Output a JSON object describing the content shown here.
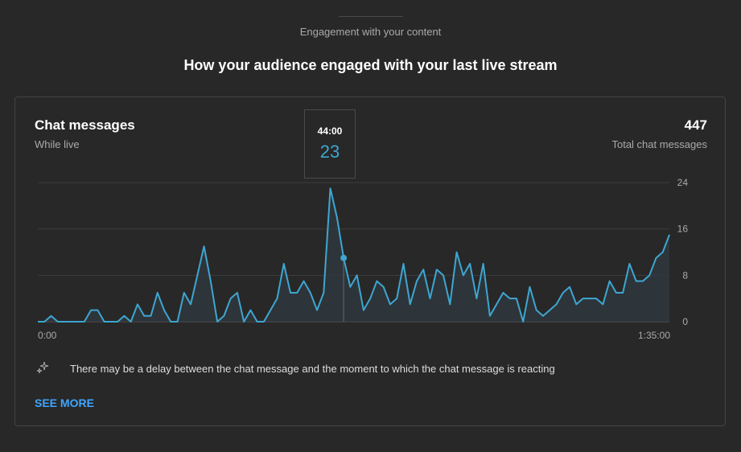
{
  "header": {
    "section_label": "Engagement with your content",
    "heading": "How your audience engaged with your last live stream"
  },
  "card": {
    "title": "Chat messages",
    "subtitle": "While live",
    "total_value": "447",
    "total_label": "Total chat messages",
    "note": "There may be a delay between the chat message and the moment to which the chat message is reacting",
    "see_more": "SEE MORE",
    "tooltip": {
      "time": "44:00",
      "value": "23",
      "index": 46
    }
  },
  "colors": {
    "accent": "#3ea6d1",
    "link": "#3ea6ff",
    "background": "#282828"
  },
  "chart_data": {
    "type": "area",
    "x_labels": [
      "0:00",
      "1:35:00"
    ],
    "y_ticks": [
      "0",
      "8",
      "16",
      "24"
    ],
    "ylim": [
      0,
      24
    ],
    "grid": true,
    "values": [
      0,
      0,
      1,
      0,
      0,
      0,
      0,
      0,
      2,
      2,
      0,
      0,
      0,
      1,
      0,
      3,
      1,
      1,
      5,
      2,
      0,
      0,
      5,
      3,
      8,
      13,
      7,
      0,
      1,
      4,
      5,
      0,
      2,
      0,
      0,
      2,
      4,
      10,
      5,
      5,
      7,
      5,
      2,
      5,
      23,
      18,
      11,
      6,
      8,
      2,
      4,
      7,
      6,
      3,
      4,
      10,
      3,
      7,
      9,
      4,
      9,
      8,
      3,
      12,
      8,
      10,
      4,
      10,
      1,
      3,
      5,
      4,
      4,
      0,
      6,
      2,
      1,
      2,
      3,
      5,
      6,
      3,
      4,
      4,
      4,
      3,
      7,
      5,
      5,
      10,
      7,
      7,
      8,
      11,
      12,
      15
    ]
  }
}
